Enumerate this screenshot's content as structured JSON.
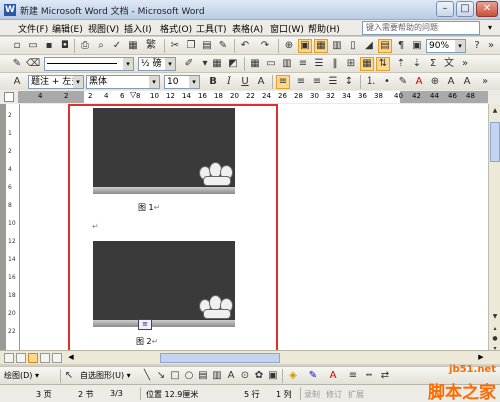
{
  "window": {
    "title": "新建 Microsoft Word 文档 - Microsoft Word"
  },
  "menu": [
    "文件(F)",
    "编辑(E)",
    "视图(V)",
    "插入(I)",
    "格式(O)",
    "工具(T)",
    "表格(A)",
    "窗口(W)",
    "帮助(H)"
  ],
  "help_placeholder": "键入需要帮助的问题",
  "toolbar": {
    "zoom": "90%",
    "font_color_label": "½ 磅"
  },
  "format_toolbar": {
    "style": "题注 + 左多",
    "font": "黑体",
    "size": "10"
  },
  "ruler_numbers": [
    "4",
    "2",
    "2",
    "4",
    "6",
    "8",
    "10",
    "12",
    "14",
    "16",
    "18",
    "20",
    "22",
    "24",
    "26",
    "28",
    "30",
    "32",
    "34",
    "36",
    "38",
    "40",
    "42",
    "44",
    "46",
    "48"
  ],
  "vruler_numbers": [
    "2",
    "1",
    "2",
    "4",
    "6",
    "8",
    "10",
    "12",
    "14",
    "16",
    "18",
    "20",
    "22"
  ],
  "document": {
    "caption1": "图 1",
    "caption2": "图 2",
    "para_mark": "↵"
  },
  "drawing": {
    "draw_label": "绘图(D) ▾",
    "autoshape_label": "自选图形(U) ▾"
  },
  "status": {
    "page": "3 页",
    "section": "2 节",
    "pages": "3/3",
    "position": "位置 12.9厘米",
    "line": "5 行",
    "col": "1 列",
    "rec": "录制",
    "trk": "修订",
    "ext": "扩展"
  },
  "watermark": {
    "site": "jb51.net",
    "name": "脚本之家"
  }
}
